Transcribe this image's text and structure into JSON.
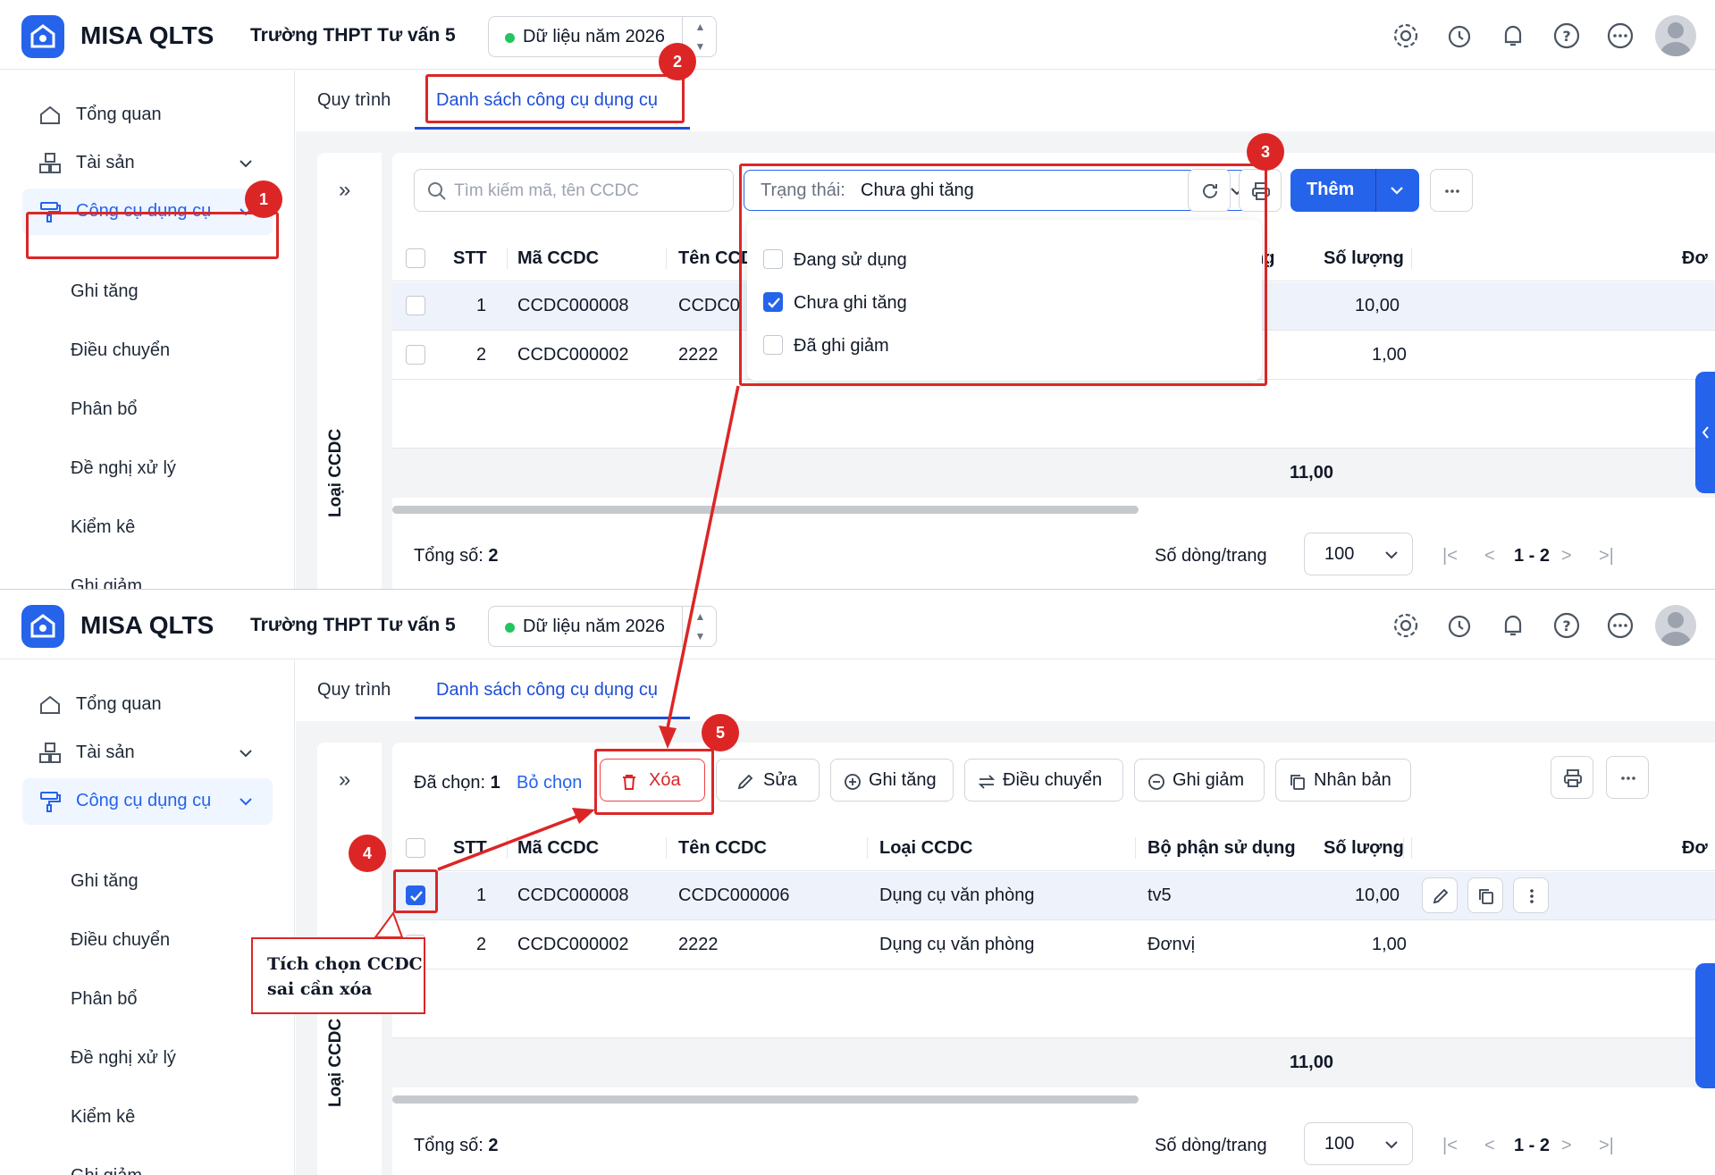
{
  "header": {
    "app_name": "MISA QLTS",
    "school_name": "Trường THPT Tư vấn 5",
    "data_year": "Dữ liệu năm 2026",
    "icons": [
      "gear-icon",
      "alarm-icon",
      "bell-icon",
      "help-icon",
      "more-icon",
      "avatar"
    ]
  },
  "sidebar": {
    "items": [
      {
        "label": "Tổng quan"
      },
      {
        "label": "Tài sản"
      },
      {
        "label": "Công cụ dụng cụ"
      }
    ],
    "sub_items": [
      "Ghi tăng",
      "Điều chuyển",
      "Phân bổ",
      "Đề nghị xử lý",
      "Kiểm kê",
      "Ghi giảm"
    ]
  },
  "tabs": [
    "Quy trình",
    "Danh sách công cụ dụng cụ"
  ],
  "left_panel": {
    "expand_glyph": "»",
    "vertical_label": "Loại CCDC"
  },
  "toolbar": {
    "search_placeholder": "Tìm kiếm mã, tên CCDC",
    "status_label": "Trạng thái:",
    "status_value": "Chưa ghi tăng",
    "add_label": "Thêm"
  },
  "status_options": [
    {
      "label": "Đang sử dụng",
      "checked": false
    },
    {
      "label": "Chưa ghi tăng",
      "checked": true
    },
    {
      "label": "Đã ghi giảm",
      "checked": false
    }
  ],
  "table": {
    "columns": [
      "STT",
      "Mã CCDC",
      "Tên CCDC",
      "Loại CCDC",
      "Bộ phận sử dụng",
      "Số lượng",
      "Đơ"
    ],
    "col_partial_top": "Tên CCD",
    "col_partial_hidden": "ng",
    "rows": [
      {
        "stt": "1",
        "code": "CCDC000008",
        "name": "CCDC000006",
        "type": "Dụng cụ văn phòng",
        "dept": "tv5",
        "qty": "10,00",
        "name_partial": "CCDC0"
      },
      {
        "stt": "2",
        "code": "CCDC000002",
        "name": "2222",
        "type": "Dụng cụ văn phòng",
        "dept": "Đơnvị",
        "qty": "1,00",
        "name_partial": "2222"
      }
    ],
    "total_qty": "11,00"
  },
  "footer": {
    "total": "Tổng số: ",
    "total_count": "2",
    "rows_per_page_label": "Số dòng/trang",
    "rows_per_page": "100",
    "page_range": "1 - 2"
  },
  "action_bar": {
    "selected_label": "Đã chọn: ",
    "selected_count": "1",
    "unselect": "Bỏ chọn",
    "buttons": [
      "Xóa",
      "Sửa",
      "Ghi tăng",
      "Điều chuyển",
      "Ghi giảm",
      "Nhân bản"
    ]
  },
  "annotations": {
    "badges": [
      "1",
      "2",
      "3",
      "4",
      "5"
    ],
    "callout_line1": "Tích chọn CCDC",
    "callout_line2": "sai cần xóa",
    "accent": "#dc2626"
  },
  "colors": {
    "primary": "#2563eb",
    "danger": "#dc2626",
    "success": "#22c55e"
  }
}
